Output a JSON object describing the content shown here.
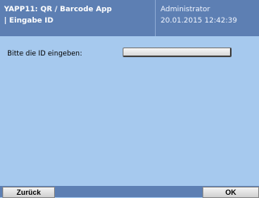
{
  "header": {
    "title": "YAPP11: QR / Barcode App",
    "subtitle": "| Eingabe ID",
    "user": "Administrator",
    "datetime": "20.01.2015 12:42:39"
  },
  "form": {
    "id_label": "Bitte die ID eingeben:",
    "id_value": ""
  },
  "footer": {
    "back_label": "Zurück",
    "ok_label": "OK"
  },
  "colors": {
    "header": "#5d7fb3",
    "background": "#a6c9ee"
  }
}
